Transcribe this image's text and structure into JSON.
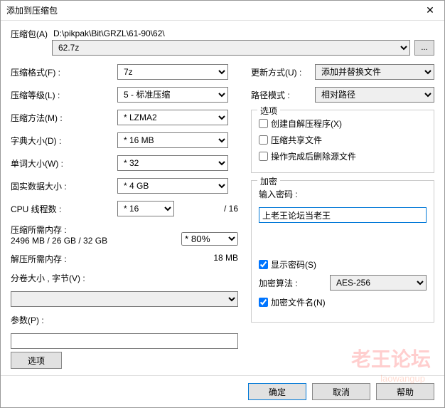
{
  "title": "添加到压缩包",
  "archive": {
    "label": "压缩包(A)",
    "path": "D:\\pikpak\\Bit\\GRZL\\61-90\\62\\",
    "file": "62.7z",
    "browse": "..."
  },
  "left": {
    "format_label": "压缩格式(F) :",
    "format_value": "7z",
    "level_label": "压缩等级(L) :",
    "level_value": "5 - 标准压缩",
    "method_label": "压缩方法(M) :",
    "method_value": "LZMA2",
    "dict_label": "字典大小(D) :",
    "dict_value": "16 MB",
    "word_label": "单词大小(W) :",
    "word_value": "32",
    "solid_label": "固实数据大小 :",
    "solid_value": "4 GB",
    "cpu_label": "CPU 线程数 :",
    "cpu_value": "16",
    "cpu_suffix": "/ 16",
    "mem_compress_label": "压缩所需内存 :",
    "mem_compress_value": "2496 MB / 26 GB / 32 GB",
    "mem_percent": "80%",
    "mem_decompress_label": "解压所需内存 :",
    "mem_decompress_value": "18 MB",
    "volumes_label": "分卷大小 ,  字节(V) :",
    "param_label": "参数(P) :",
    "options_btn": "选项"
  },
  "right": {
    "update_label": "更新方式(U) :",
    "update_value": "添加并替换文件",
    "path_label": "路径模式 :",
    "path_value": "相对路径",
    "options_legend": "选项",
    "sfx_label": "创建自解压程序(X)",
    "shared_label": "压缩共享文件",
    "delete_label": "操作完成后删除源文件",
    "encrypt_legend": "加密",
    "pwd_label": "输入密码 :",
    "pwd_value": "上老王论坛当老王",
    "show_pwd_label": "显示密码(S)",
    "algo_label": "加密算法 :",
    "algo_value": "AES-256",
    "enc_names_label": "加密文件名(N)"
  },
  "footer": {
    "ok": "确定",
    "cancel": "取消",
    "help": "帮助"
  },
  "watermark": {
    "text": "老王论坛",
    "sub": "laowangup"
  }
}
